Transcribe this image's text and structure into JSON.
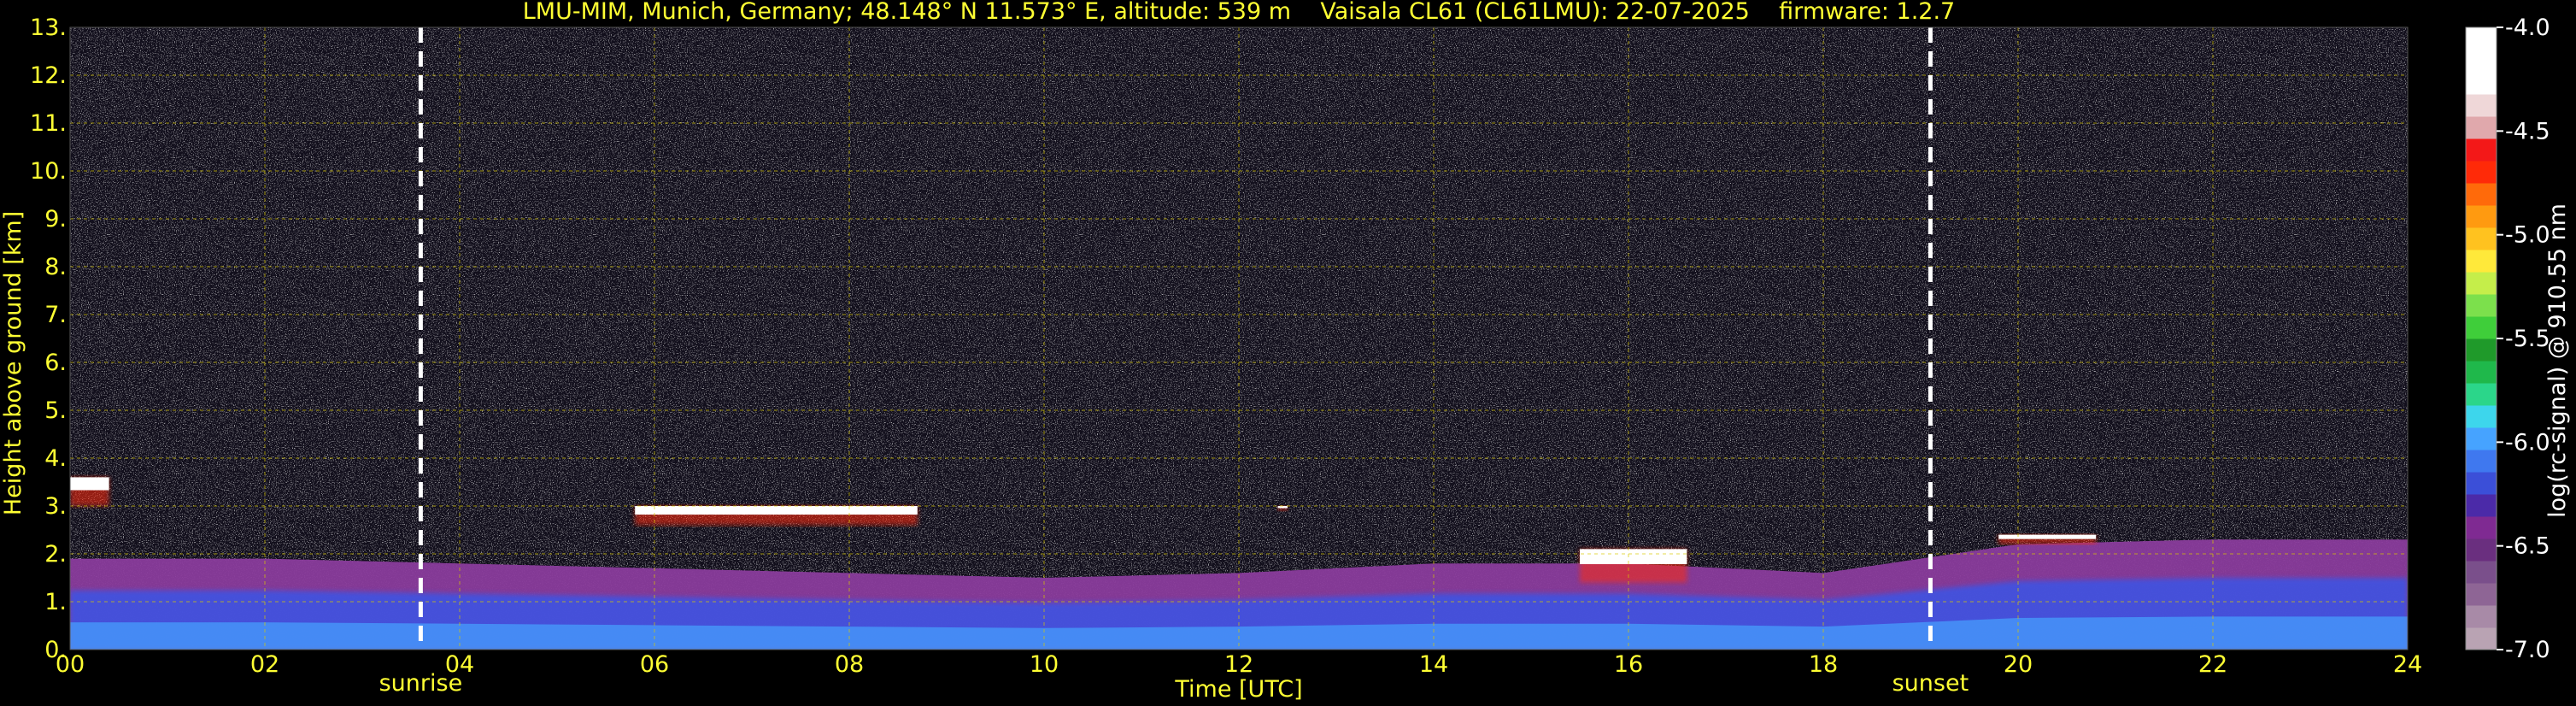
{
  "chart_data": {
    "type": "heatmap",
    "title": "LMU-MIM, Munich, Germany; 48.148° N 11.573° E, altitude: 539 m    Vaisala CL61 (CL61LMU): 22-07-2025    firmware: 1.2.7",
    "xlabel": "Time [UTC]",
    "ylabel": "Height above ground [km]",
    "xlim": [
      0,
      24
    ],
    "ylim": [
      0,
      13
    ],
    "xticks": [
      "00",
      "02",
      "04",
      "06",
      "08",
      "10",
      "12",
      "14",
      "16",
      "18",
      "20",
      "22",
      "24"
    ],
    "yticks": [
      "0.",
      "1.",
      "2.",
      "3.",
      "4.",
      "5.",
      "6.",
      "7.",
      "8.",
      "9.",
      "10.",
      "11.",
      "12.",
      "13."
    ],
    "grid": true,
    "markers": [
      {
        "label": "sunrise",
        "time": 3.6
      },
      {
        "label": "sunset",
        "time": 19.1
      }
    ],
    "colorbar": {
      "label": "log(rc-signal) @ 910.55 nm",
      "ticks": [
        "-4.0",
        "-4.5",
        "-5.0",
        "-5.5",
        "-6.0",
        "-6.5",
        "-7.0"
      ],
      "range": [
        -7.0,
        -4.0
      ],
      "colors": [
        "#b9a3b3",
        "#a88aa7",
        "#8e6595",
        "#7a4f8b",
        "#6a2f7f",
        "#7f2a92",
        "#4b2aa8",
        "#3b4fd8",
        "#3f78ef",
        "#46a3ff",
        "#3dd6ec",
        "#2bd68a",
        "#1fb84b",
        "#1f9a2a",
        "#3fce3a",
        "#7ce04c",
        "#c5ee4a",
        "#ffe93a",
        "#ffc21f",
        "#ff9a10",
        "#ff6a0a",
        "#ff2a08",
        "#f31818",
        "#e0a8ac",
        "#efd7d8",
        "#ffffff",
        "#ffffff",
        "#ffffff"
      ]
    },
    "cloud_layers": [
      {
        "t0": 0.0,
        "t1": 0.4,
        "base_km": 3.0,
        "top_km": 3.6
      },
      {
        "t0": 5.8,
        "t1": 8.7,
        "base_km": 2.6,
        "top_km": 3.0
      },
      {
        "t0": 12.4,
        "t1": 12.5,
        "base_km": 2.9,
        "top_km": 3.0
      },
      {
        "t0": 15.5,
        "t1": 16.6,
        "base_km": 1.4,
        "top_km": 2.1
      },
      {
        "t0": 19.8,
        "t1": 20.8,
        "base_km": 2.2,
        "top_km": 2.4
      }
    ],
    "boundary_layer": [
      {
        "t": 0,
        "top_km": 1.9
      },
      {
        "t": 2,
        "top_km": 1.9
      },
      {
        "t": 4,
        "top_km": 1.8
      },
      {
        "t": 6,
        "top_km": 1.7
      },
      {
        "t": 8,
        "top_km": 1.6
      },
      {
        "t": 10,
        "top_km": 1.5
      },
      {
        "t": 12,
        "top_km": 1.6
      },
      {
        "t": 14,
        "top_km": 1.8
      },
      {
        "t": 16,
        "top_km": 1.8
      },
      {
        "t": 18,
        "top_km": 1.6
      },
      {
        "t": 20,
        "top_km": 2.2
      },
      {
        "t": 22,
        "top_km": 2.3
      },
      {
        "t": 24,
        "top_km": 2.3
      }
    ]
  }
}
